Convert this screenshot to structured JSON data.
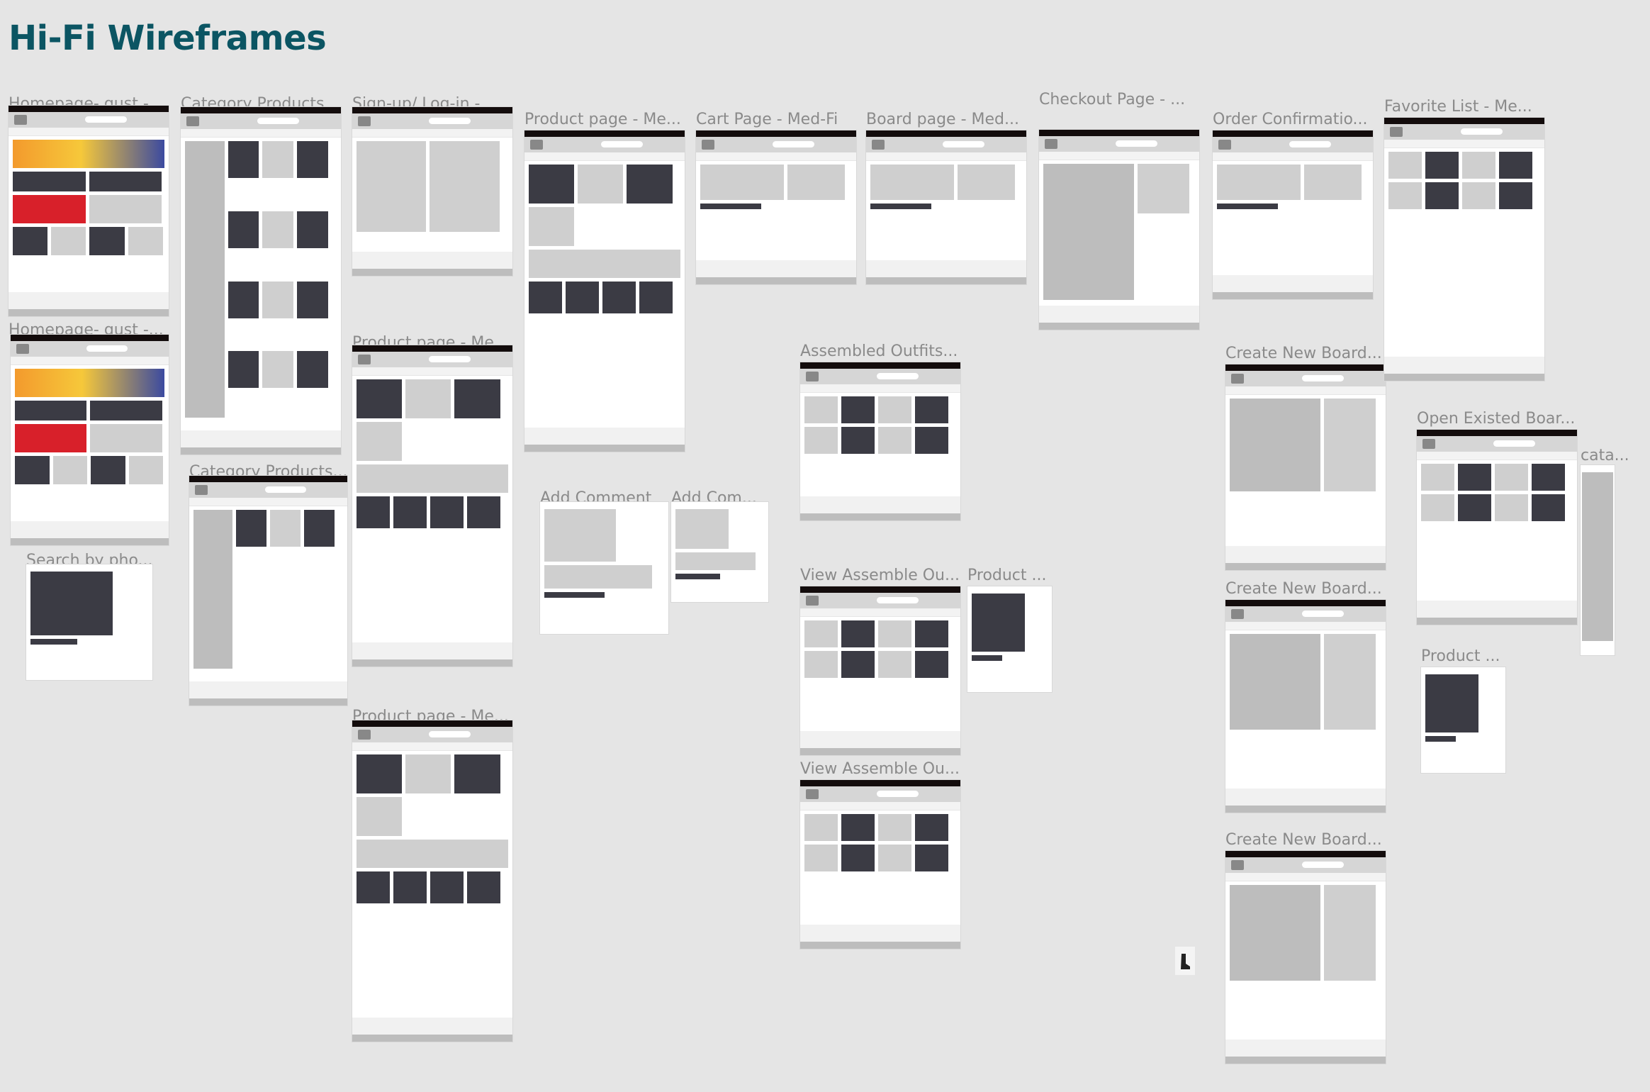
{
  "canvas": {
    "title": "Hi-Fi Wireframes",
    "accent_color": "#0b5563",
    "frames": [
      {
        "label": "Homepage- gust -...",
        "kind": "home"
      },
      {
        "label": "Homepage- gust -...",
        "kind": "home"
      },
      {
        "label": "Search by pho...",
        "kind": "photo"
      },
      {
        "label": "Category Products...",
        "kind": "category"
      },
      {
        "label": "Category Products...",
        "kind": "category"
      },
      {
        "label": "Sign-up/ Log-in - ...",
        "kind": "login"
      },
      {
        "label": "Product page - Me...",
        "kind": "product"
      },
      {
        "label": "Product page - Me...",
        "kind": "product"
      },
      {
        "label": "Product page - Me...",
        "kind": "product"
      },
      {
        "label": "Add Comment",
        "kind": "modal"
      },
      {
        "label": "Add Com...",
        "kind": "modal"
      },
      {
        "label": "Cart Page - Med-Fi",
        "kind": "cart"
      },
      {
        "label": "Board page - Med...",
        "kind": "cart"
      },
      {
        "label": "Assembled Outfits...",
        "kind": "grid"
      },
      {
        "label": "View Assemble Ou...",
        "kind": "grid"
      },
      {
        "label": "View Assemble Ou...",
        "kind": "grid"
      },
      {
        "label": "Product ...",
        "kind": "photo"
      },
      {
        "label": "Checkout Page - ...",
        "kind": "checkout"
      },
      {
        "label": "Order Confirmatio...",
        "kind": "cart"
      },
      {
        "label": "Create New Board...",
        "kind": "board"
      },
      {
        "label": "Create New Board...",
        "kind": "board"
      },
      {
        "label": "Create New Board...",
        "kind": "board"
      },
      {
        "label": "Favorite List - Me...",
        "kind": "grid"
      },
      {
        "label": "Open Existed Boar...",
        "kind": "grid"
      },
      {
        "label": "cata...",
        "kind": "sidebar"
      },
      {
        "label": "Product ...",
        "kind": "photo"
      }
    ]
  }
}
